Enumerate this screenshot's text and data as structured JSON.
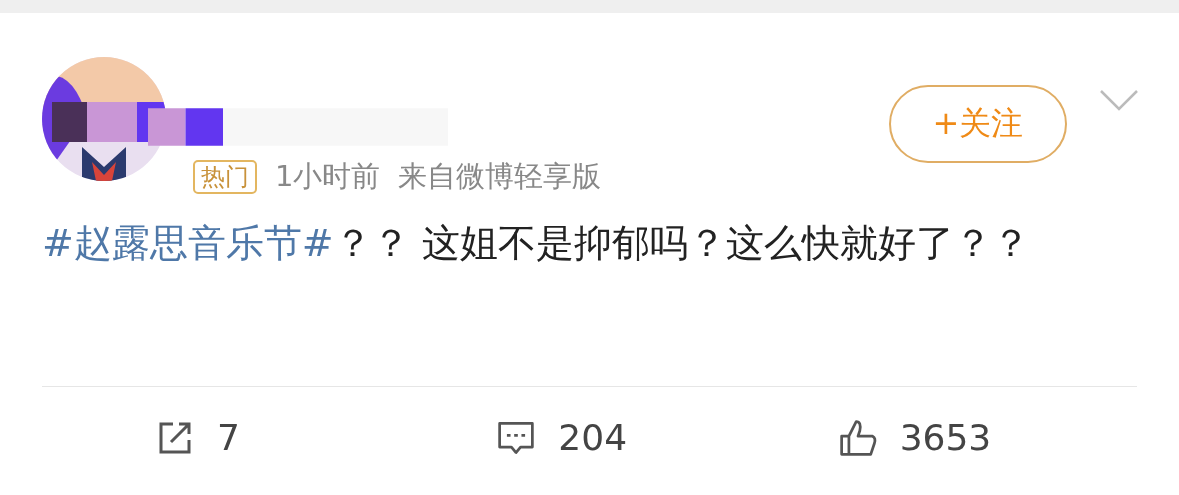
{
  "post": {
    "tag": "热门",
    "time": "1小时前",
    "source": "来自微博轻享版",
    "follow_label": "+关注",
    "hashtag": "#赵露思音乐节#",
    "text": "？？ 这姐不是抑郁吗？这么快就好了？？"
  },
  "actions": [
    {
      "kind": "repost",
      "count": "7"
    },
    {
      "kind": "comment",
      "count": "204"
    },
    {
      "kind": "like",
      "count": "3653"
    }
  ]
}
